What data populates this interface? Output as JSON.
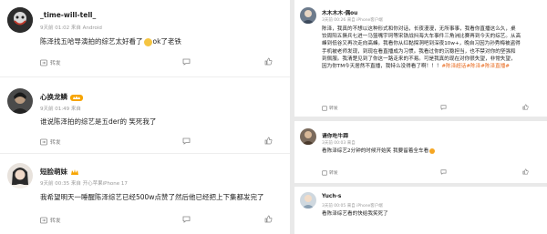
{
  "left": {
    "posts": [
      {
        "name": "_time-will-tell_",
        "meta": "9天前 01:02 来自 Android",
        "text": "陈泽找五哈导演拍的综艺太好看了",
        "text_suffix": "ok了老铁",
        "repost": "转发"
      },
      {
        "name": "心换龙鳞",
        "meta": "9天前 01:49 来自",
        "text": "谁说陈泽拍的综艺是五der的 笑死我了",
        "repost": "转发"
      },
      {
        "name": "短脸萌妹",
        "meta": "9天前 00:35 来自 开心苹果iPhone 17",
        "text": "我希望明天一睡醒陈泽综艺已经500w点赞了然后他已经把上下集都发完了",
        "repost": "转发"
      }
    ]
  },
  "right": {
    "top": {
      "name": "木木木木·偶ou",
      "meta": "3天前 00:26 来自 iPhone客户端",
      "lines": [
        "陈泽，我真的不想以这种形式和你对话，长夜漫漫，无所事事，我看你直播这么久，桌",
        "饺周阳五撅兵七进一马篮嘴宇珂等宋铁战抖海大车事件三角洲比赛再到今天的综艺。从高",
        "峰到低谷又再次走向高峰。我看你从红黏探洞吧到深夜10w+，晚自习因为孙秀梅被盗得",
        "手机被老师发现，到现在看直播成为习惯。我看过你的沉稳担当，也不禁对你的坚强和",
        "到佩服。我清楚见到了你这一路走来的不易。可是我真的现在对你很失望，非常失望，",
        "因为你TM今天居然不直播，我特么没得看了啊！！！"
      ],
      "tags": "#陈泽超话#陈泽#陈泽直播#",
      "repost": "转发"
    },
    "mid": {
      "name": "请你吃牛蹄",
      "meta": "3天前 00:03 来自",
      "lines": [
        "看陈泽综艺2分钟的时候开始笑 我要留着全车看"
      ],
      "repost": "转发"
    },
    "bot": {
      "name": "Yuch-s",
      "meta": "3天前 00:05 来自 iPhone客户端",
      "lines": [
        "看陈泽综艺看的快给我笑死了"
      ]
    }
  }
}
